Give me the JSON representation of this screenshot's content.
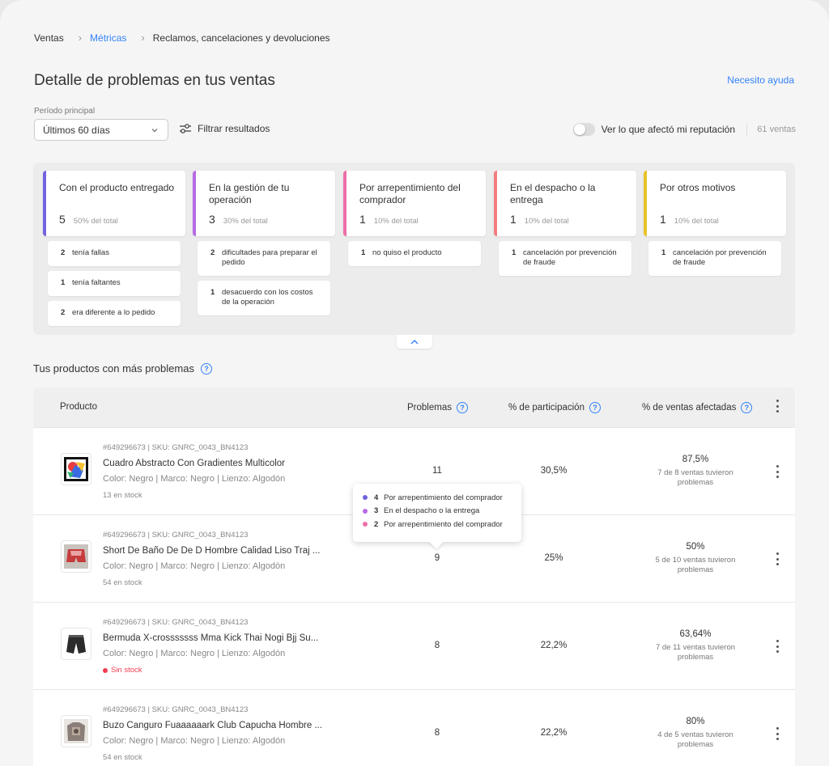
{
  "breadcrumb": {
    "item1": "Ventas",
    "item2": "Métricas",
    "item3": "Reclamos, cancelaciones y devoluciones"
  },
  "header": {
    "title": "Detalle de problemas en tus ventas",
    "help": "Necesito ayuda"
  },
  "filters": {
    "period_label": "Período principal",
    "period_value": "Últimos 60 días",
    "filter_button": "Filtrar resultados",
    "toggle_label": "Ver lo que afectó mi reputación",
    "sales_count": "61 ventas"
  },
  "categories": [
    {
      "title": "Con el producto entregado",
      "count": "5",
      "pct": "50% del total",
      "color": "#7163e0",
      "subs": [
        {
          "n": "2",
          "t": "tenía fallas"
        },
        {
          "n": "1",
          "t": "tenía faltantes"
        },
        {
          "n": "2",
          "t": "era diferente a lo pedido"
        }
      ]
    },
    {
      "title": "En la gestión de tu operación",
      "count": "3",
      "pct": "30% del total",
      "color": "#b86be5",
      "subs": [
        {
          "n": "2",
          "t": "dificultades para preparar el pedido"
        },
        {
          "n": "1",
          "t": "desacuerdo con los costos de la operación"
        }
      ]
    },
    {
      "title": "Por arrepentimiento del comprador",
      "count": "1",
      "pct": "10% del total",
      "color": "#ee6ea8",
      "subs": [
        {
          "n": "1",
          "t": "no quiso el producto"
        }
      ]
    },
    {
      "title": "En el despacho o la entrega",
      "count": "1",
      "pct": "10% del total",
      "color": "#f47e7e",
      "subs": [
        {
          "n": "1",
          "t": "cancelación por prevención de fraude"
        }
      ]
    },
    {
      "title": "Por otros motivos",
      "count": "1",
      "pct": "10% del total",
      "color": "#e8c22a",
      "subs": [
        {
          "n": "1",
          "t": "cancelación por prevención de fraude"
        }
      ]
    }
  ],
  "products_section": {
    "title": "Tus productos con más problemas"
  },
  "table": {
    "headers": {
      "product": "Producto",
      "problems": "Problemas",
      "participation": "% de participación",
      "affected": "% de ventas afectadas"
    },
    "rows": [
      {
        "sku": "#649296673 | SKU: GNRC_0043_BN4123",
        "name": "Cuadro Abstracto Con Gradientes Multicolor",
        "attrs": "Color: Negro | Marco: Negro | Lienzo: Algodón",
        "stock": "13 en stock",
        "problems": "11",
        "participation": "30,5%",
        "affected_pct": "87,5%",
        "affected_desc": "7 de 8 ventas tuvieron problemas"
      },
      {
        "sku": "#649296673 | SKU: GNRC_0043_BN4123",
        "name": "Short De Baño De De D Hombre Calidad Liso Traj ...",
        "attrs": "Color: Negro | Marco: Negro | Lienzo: Algodón",
        "stock": "54 en stock",
        "problems": "9",
        "participation": "25%",
        "affected_pct": "50%",
        "affected_desc": "5 de 10 ventas tuvieron problemas"
      },
      {
        "sku": "#649296673 | SKU: GNRC_0043_BN4123",
        "name": "Bermuda X-crosssssss Mma Kick Thai Nogi Bjj Su...",
        "attrs": "Color: Negro | Marco: Negro | Lienzo: Algodón",
        "stock": "Sin stock",
        "problems": "8",
        "participation": "22,2%",
        "affected_pct": "63,64%",
        "affected_desc": "7 de 11 ventas tuvieron problemas"
      },
      {
        "sku": "#649296673 | SKU: GNRC_0043_BN4123",
        "name": "Buzo Canguro Fuaaaaaark Club Capucha Hombre ...",
        "attrs": "Color: Negro | Marco: Negro | Lienzo: Algodón",
        "stock": "54 en stock",
        "problems": "8",
        "participation": "22,2%",
        "affected_pct": "80%",
        "affected_desc": "4 de 5 ventas tuvieron problemas"
      }
    ]
  },
  "tooltip": {
    "items": [
      {
        "n": "4",
        "t": "Por arrepentimiento del comprador",
        "color": "#7163e0"
      },
      {
        "n": "3",
        "t": "En el despacho o la entrega",
        "color": "#b86be5"
      },
      {
        "n": "2",
        "t": "Por arrepentimiento del comprador",
        "color": "#ee6ea8"
      }
    ]
  }
}
